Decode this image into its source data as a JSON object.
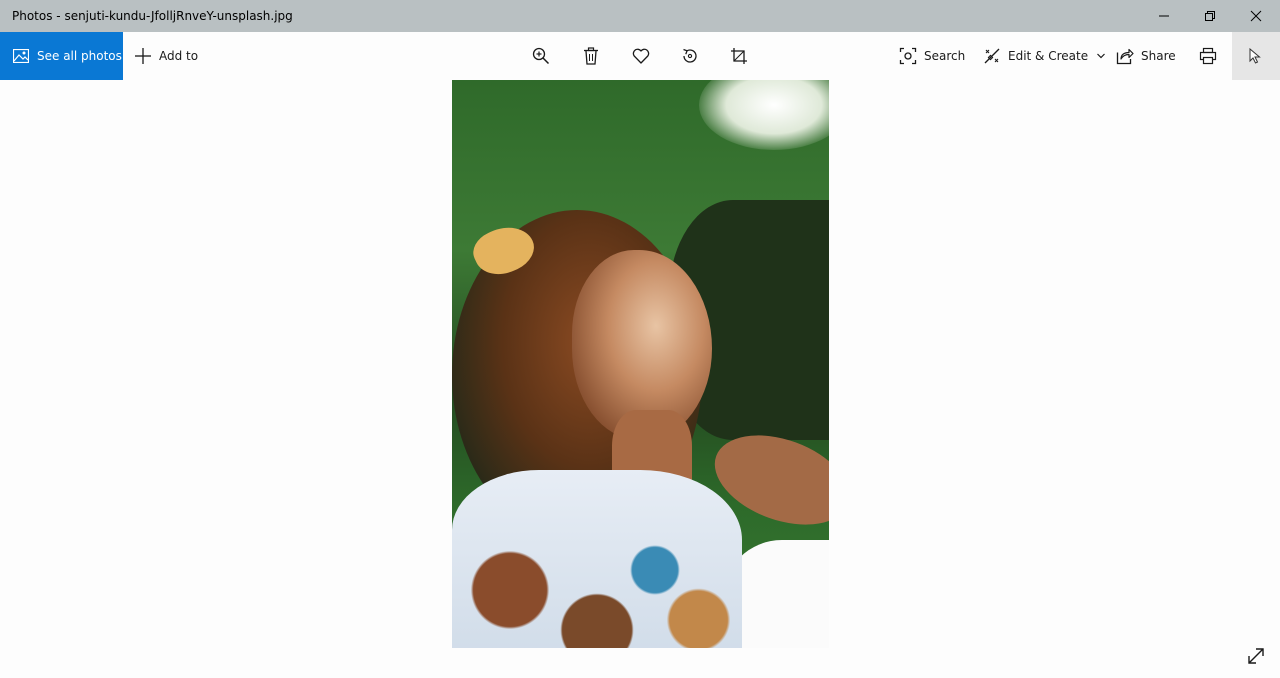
{
  "window": {
    "title": "Photos - senjuti-kundu-JfolljRnveY-unsplash.jpg",
    "minimize_icon": "minimize-icon",
    "restore_icon": "restore-icon",
    "close_icon": "close-icon"
  },
  "toolbar": {
    "see_all_label": "See all photos",
    "add_to_label": "Add to",
    "search_label": "Search",
    "edit_create_label": "Edit & Create",
    "share_label": "Share",
    "icons": [
      "zoom-icon",
      "delete-icon",
      "heart-icon",
      "rotate-icon",
      "crop-icon",
      "print-icon",
      "more-icon"
    ]
  },
  "colors": {
    "titlebar": "#b9c0c2",
    "accent": "#0a78d4",
    "background": "#fdfdfd"
  },
  "photo": {
    "description_icon": "photo-image"
  }
}
